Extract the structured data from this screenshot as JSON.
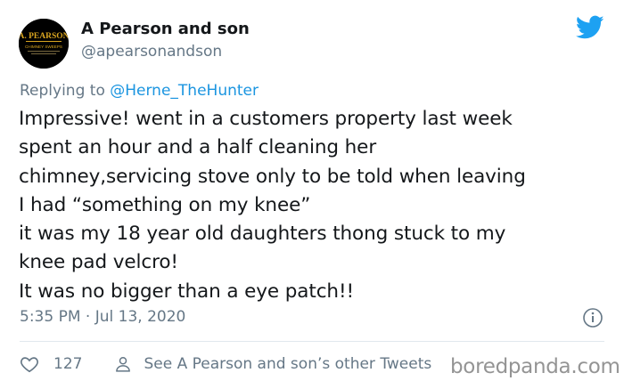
{
  "author": {
    "display_name": "A Pearson and son",
    "handle": "@apearsonandson",
    "avatar_text": {
      "line1": "A. PEARSON",
      "line2": "CHIMNEY SWEEPS"
    }
  },
  "reply": {
    "prefix": "Replying to ",
    "mention": "@Herne_TheHunter"
  },
  "tweet": {
    "lines": [
      "Impressive! went in a customers property last week",
      "spent an hour and a half cleaning her",
      "chimney,servicing stove only to be told when leaving",
      "I had “something on my knee”",
      "it was my 18 year old daughters thong stuck to my",
      "knee pad velcro!",
      "It was no bigger than a eye patch!!"
    ],
    "timestamp": "5:35 PM · Jul 13, 2020"
  },
  "actions": {
    "like_count": "127",
    "other_tweets_label": "See A Pearson and son’s other Tweets"
  },
  "watermark": "boredpanda.com",
  "colors": {
    "text_primary": "#14171a",
    "text_secondary": "#657786",
    "twitter_blue": "#1da1f2",
    "mention_blue": "#1b95e0",
    "divider": "#e1e8ed"
  },
  "icons": {
    "brand": "twitter-bird-icon",
    "info": "info-icon",
    "like": "heart-icon",
    "profile": "person-icon"
  }
}
